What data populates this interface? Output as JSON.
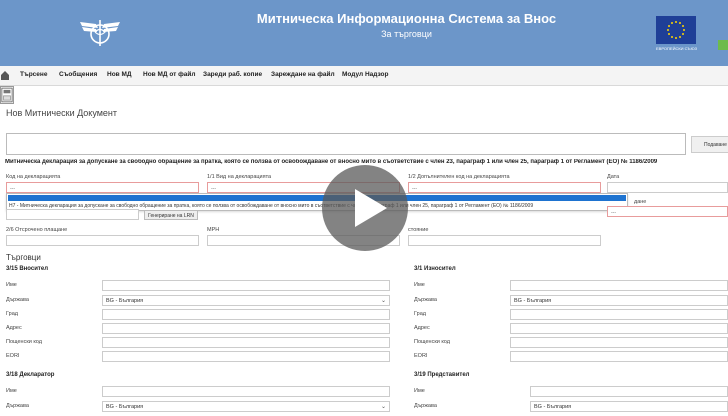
{
  "header": {
    "title": "Митническа Информационна Система за Внос",
    "subtitle": "За търговци",
    "eu_caption": "ЕВРОПЕЙСКИ СЪЮЗ",
    "bg_color": "#6c96c9"
  },
  "menu": {
    "items": [
      "Търсене",
      "Съобщения",
      "Нов МД",
      "Нов МД от файл",
      "Зареди раб. копие",
      "Зареждане на файл",
      "Модул Надзор"
    ]
  },
  "page": {
    "title": "Нов Митнически Документ",
    "search_button": "Подаване",
    "declaration_heading": "Митническа декларация за допускане за свободно обращение за пратка, която се ползва от освобождаване от вносно мито в съответствие с член 23, параграф 1 или член 25, параграф 1 от Регламент (ЕО) № 1186/2009"
  },
  "form": {
    "decl_code_label": "Код на декларацията",
    "decl_code_value": "---",
    "type_label": "1/1 Вид на декларацията",
    "type_value": "---",
    "additional_label": "1/2 Допълнителен код на декларацията",
    "additional_value": "---",
    "date_label": "Дата",
    "dropdown_option": "H7 - Митническа декларация за допускане за свободно обращение за пратка, която се ползва от освобождаване от вносно мито в съответствие с член 23, параграф 1 или член 25, параграф 1 от Регламент (ЕО) № 1186/2009",
    "lrn_button": "Генериране на LRN",
    "deferred_label": "2/6 Отсрочено плащане",
    "mrn_label": "MPH",
    "right_partial_1": "дане",
    "right_partial_2": "стояние",
    "right_value": "---"
  },
  "traders": {
    "section_title": "Търговци",
    "consignee": {
      "title": "3/15 Вносител",
      "name_label": "Име",
      "country_label": "Държава",
      "country_value": "BG - България",
      "city_label": "Град",
      "address_label": "Адрес",
      "postal_label": "Пощенски код",
      "eori_label": "EORI"
    },
    "exporter": {
      "title": "3/1 Износител",
      "name_label": "Име",
      "country_label": "Държава",
      "country_value": "BG - България",
      "city_label": "Град",
      "address_label": "Адрес",
      "postal_label": "Пощенски код",
      "eori_label": "EORI"
    },
    "declarant": {
      "title": "3/18 Декларатор",
      "name_label": "Име",
      "country_label": "Държава",
      "country_value": "BG - България"
    },
    "representative": {
      "title": "3/19 Представител",
      "name_label": "Име",
      "country_label": "Държава",
      "country_value": "BG - България"
    }
  }
}
